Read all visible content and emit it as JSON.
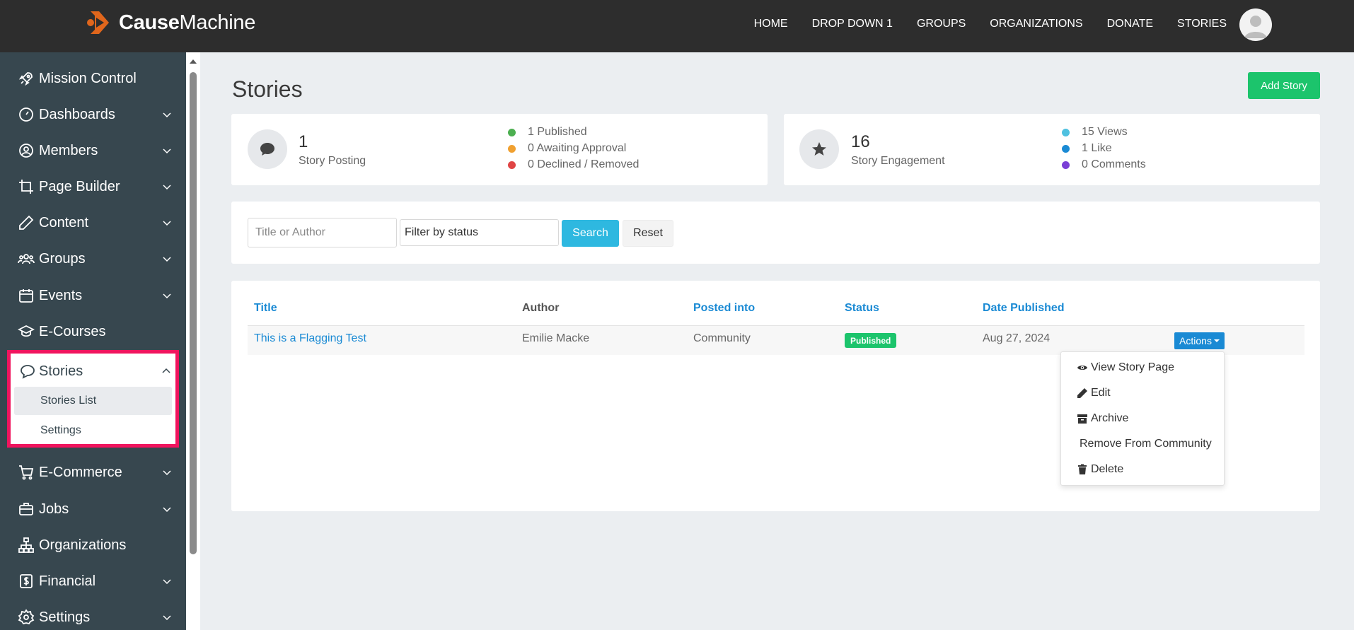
{
  "brand": {
    "name_bold": "Cause",
    "name_rest": "Machine"
  },
  "topnav": [
    "HOME",
    "DROP DOWN 1",
    "GROUPS",
    "ORGANIZATIONS",
    "DONATE",
    "STORIES"
  ],
  "sidebar": {
    "items": [
      {
        "label": "Mission Control",
        "icon": "rocket-icon",
        "chevron": false
      },
      {
        "label": "Dashboards",
        "icon": "gauge-icon",
        "chevron": true
      },
      {
        "label": "Members",
        "icon": "user-circle-icon",
        "chevron": true
      },
      {
        "label": "Page Builder",
        "icon": "crop-icon",
        "chevron": true
      },
      {
        "label": "Content",
        "icon": "pencil-icon",
        "chevron": true
      },
      {
        "label": "Groups",
        "icon": "users-icon",
        "chevron": true
      },
      {
        "label": "Events",
        "icon": "calendar-icon",
        "chevron": true
      },
      {
        "label": "E-Courses",
        "icon": "graduation-cap-icon",
        "chevron": false
      },
      {
        "label": "Stories",
        "icon": "speech-bubble-icon",
        "chevron": true,
        "expanded": true
      },
      {
        "label": "E-Commerce",
        "icon": "cart-icon",
        "chevron": true
      },
      {
        "label": "Jobs",
        "icon": "briefcase-icon",
        "chevron": true
      },
      {
        "label": "Organizations",
        "icon": "sitemap-icon",
        "chevron": false
      },
      {
        "label": "Financial",
        "icon": "dollar-square-icon",
        "chevron": true
      },
      {
        "label": "Settings",
        "icon": "gear-icon",
        "chevron": true
      }
    ],
    "stories_sub": [
      "Stories List",
      "Settings"
    ]
  },
  "page": {
    "title": "Stories",
    "add_button": "Add Story"
  },
  "stats": {
    "posting": {
      "value": "1",
      "label": "Story Posting",
      "legend": [
        {
          "text": "1 Published",
          "color": "#4caf50"
        },
        {
          "text": "0 Awaiting Approval",
          "color": "#f0a030"
        },
        {
          "text": "0 Declined / Removed",
          "color": "#e04545"
        }
      ]
    },
    "engagement": {
      "value": "16",
      "label": "Story Engagement",
      "legend": [
        {
          "text": "15 Views",
          "color": "#4fc1e0"
        },
        {
          "text": "1 Like",
          "color": "#1a8ad4"
        },
        {
          "text": "0 Comments",
          "color": "#7b3fd6"
        }
      ]
    }
  },
  "filters": {
    "search_placeholder": "Title or Author",
    "status_placeholder": "Filter by status",
    "search_button": "Search",
    "reset_button": "Reset"
  },
  "table": {
    "headers": [
      "Title",
      "Author",
      "Posted into",
      "Status",
      "Date Published"
    ],
    "rows": [
      {
        "title": "This is a Flagging Test",
        "author": "Emilie Macke",
        "posted_into": "Community",
        "status": "Published",
        "date": "Aug 27, 2024",
        "actions": "Actions"
      }
    ]
  },
  "actions_menu": [
    "View Story Page",
    "Edit",
    "Archive",
    "Remove From Community",
    "Delete"
  ],
  "colors": {
    "accent_green": "#1cc46c",
    "accent_blue": "#1a8ad4",
    "sidebar_bg": "#37474f",
    "highlight": "#f0145e"
  }
}
